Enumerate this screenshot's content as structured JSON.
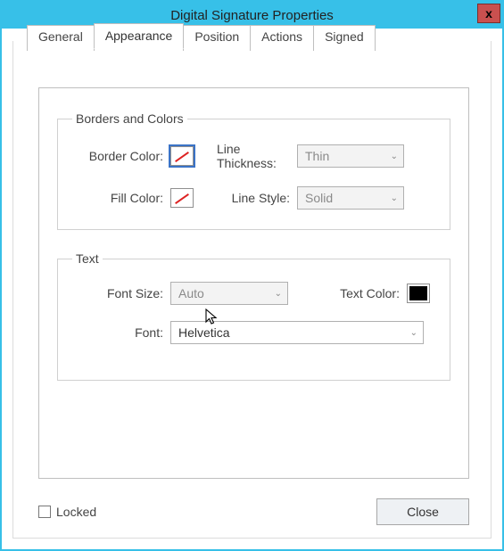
{
  "window": {
    "title": "Digital Signature Properties",
    "close_glyph": "x"
  },
  "tabs": {
    "items": [
      {
        "label": "General"
      },
      {
        "label": "Appearance"
      },
      {
        "label": "Position"
      },
      {
        "label": "Actions"
      },
      {
        "label": "Signed"
      }
    ],
    "active_index": 1
  },
  "borders_group": {
    "legend": "Borders and Colors",
    "border_color_label": "Border Color:",
    "fill_color_label": "Fill Color:",
    "line_thickness_label": "Line Thickness:",
    "line_style_label": "Line Style:",
    "line_thickness_value": "Thin",
    "line_style_value": "Solid"
  },
  "text_group": {
    "legend": "Text",
    "font_size_label": "Font Size:",
    "font_size_value": "Auto",
    "text_color_label": "Text Color:",
    "font_label": "Font:",
    "font_value": "Helvetica"
  },
  "footer": {
    "locked_label": "Locked",
    "close_label": "Close"
  },
  "glyphs": {
    "chevron_down": "⌄"
  }
}
